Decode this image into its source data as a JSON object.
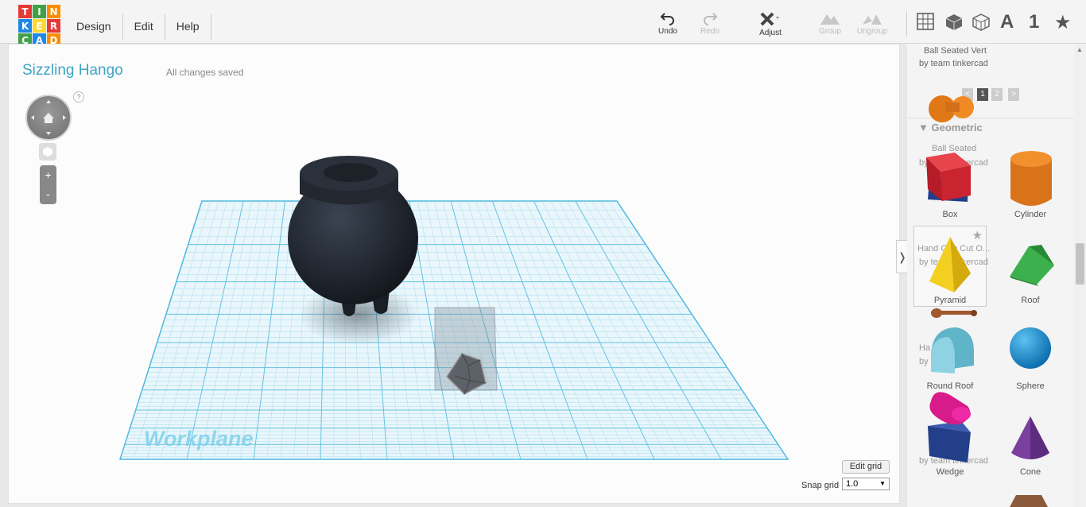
{
  "logo": {
    "letters": [
      "T",
      "I",
      "N",
      "K",
      "E",
      "R",
      "C",
      "A",
      "D"
    ],
    "colors": [
      "#e53935",
      "#43a047",
      "#fb8c00",
      "#1e88e5",
      "#fdd835",
      "#e53935",
      "#43a047",
      "#1e88e5",
      "#fb8c00"
    ]
  },
  "menu": {
    "items": [
      "Design",
      "Edit",
      "Help"
    ]
  },
  "toolbar": {
    "undo": "Undo",
    "redo": "Redo",
    "adjust": "Adjust",
    "group": "Group",
    "ungroup": "Ungroup",
    "text_glyph": "A",
    "number_glyph": "1",
    "star_glyph": "★"
  },
  "canvas": {
    "title": "Sizzling Hango",
    "status": "All changes saved",
    "help": "?",
    "zoom_in": "+",
    "zoom_out": "-",
    "workplane_label": "Workplane",
    "edit_grid": "Edit grid",
    "snap_label": "Snap grid",
    "snap_value": "1.0"
  },
  "sidebar": {
    "collapse_glyph": "❭",
    "top_item": {
      "name": "Ball Seated Vert",
      "author": "by team tinkercad"
    },
    "pages": [
      "<",
      "1",
      "2",
      ">"
    ],
    "active_page": "1",
    "section": "Geometric",
    "ghost_texts": [
      "Ball Seated",
      "by team tinkercad",
      "Hand Grip Cut O...",
      "by team tinkercad",
      "Ha         ed",
      "by       ercad",
      "by team tinkercad"
    ],
    "shapes": [
      {
        "label": "Box",
        "color": "#d32f2f"
      },
      {
        "label": "Cylinder",
        "color": "#e67e22"
      },
      {
        "label": "Pyramid",
        "color": "#f1c40f"
      },
      {
        "label": "Roof",
        "color": "#2e9e3e"
      },
      {
        "label": "Round Roof",
        "color": "#6fc3d4"
      },
      {
        "label": "Sphere",
        "color": "#1e90d6"
      },
      {
        "label": "Wedge",
        "color": "#233f8a"
      },
      {
        "label": "Cone",
        "color": "#7b3fa0"
      }
    ]
  }
}
